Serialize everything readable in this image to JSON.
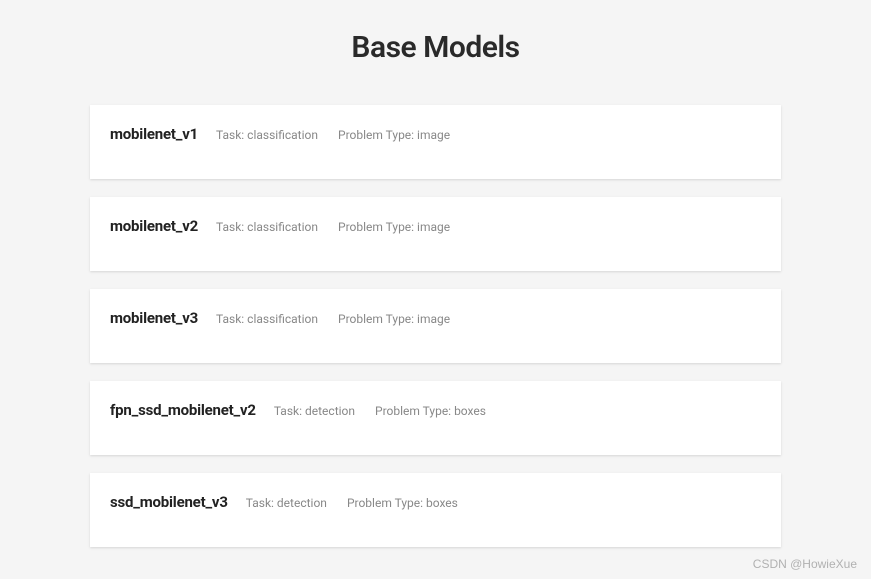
{
  "title": "Base Models",
  "models": [
    {
      "name": "mobilenet_v1",
      "task_label": "Task: classification",
      "type_label": "Problem Type: image"
    },
    {
      "name": "mobilenet_v2",
      "task_label": "Task: classification",
      "type_label": "Problem Type: image"
    },
    {
      "name": "mobilenet_v3",
      "task_label": "Task: classification",
      "type_label": "Problem Type: image"
    },
    {
      "name": "fpn_ssd_mobilenet_v2",
      "task_label": "Task: detection",
      "type_label": "Problem Type: boxes"
    },
    {
      "name": "ssd_mobilenet_v3",
      "task_label": "Task: detection",
      "type_label": "Problem Type: boxes"
    }
  ],
  "watermark": "CSDN @HowieXue"
}
